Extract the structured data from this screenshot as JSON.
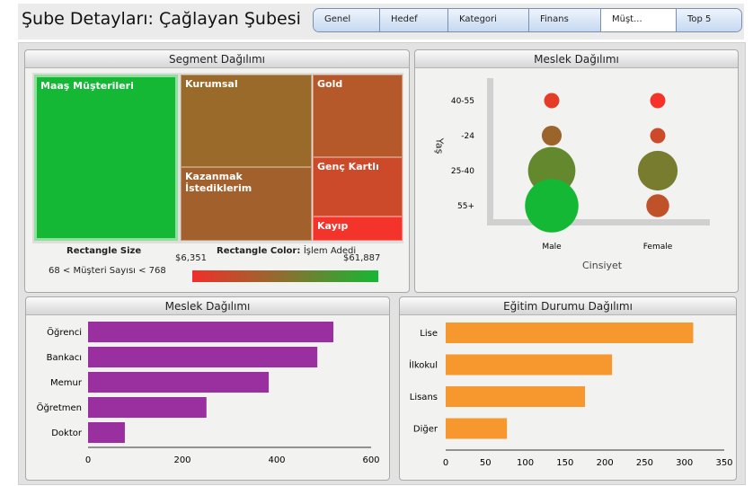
{
  "header": {
    "title": "Şube Detayları: Çağlayan Şubesi",
    "tabs": [
      {
        "label": "Genel"
      },
      {
        "label": "Hedef"
      },
      {
        "label": "Kategori"
      },
      {
        "label": "Finans"
      },
      {
        "label": "Müşt...",
        "active": true
      },
      {
        "label": "Top 5"
      }
    ]
  },
  "segment": {
    "title": "Segment Dağılımı",
    "cells": [
      {
        "label": "Maaş Müşterileri",
        "color": "#14b834"
      },
      {
        "label": "Kurumsal",
        "color": "#9a6a2a"
      },
      {
        "label": "Kazanmak İstediklerim",
        "color": "#a2602c"
      },
      {
        "label": "Gold",
        "color": "#b5592a"
      },
      {
        "label": "Genç Kartlı",
        "color": "#cc4a2a"
      },
      {
        "label": "Kayıp",
        "color": "#f4332a"
      }
    ],
    "size_heading": "Rectangle Size",
    "size_text": "68 < Müşteri Sayısı < 768",
    "color_heading": "Rectangle Color:",
    "color_metric": "İşlem Adedi",
    "color_min": "$6,351",
    "color_max": "$61,887",
    "color_low": "#f0302a",
    "color_high": "#14b834"
  },
  "bubble": {
    "title": "Meslek Dağılımı",
    "ylabel": "Yaş",
    "xlabel": "Cinsiyet",
    "y_categories": [
      "40-55",
      "-24",
      "25-40",
      "55+"
    ],
    "x_categories": [
      "Male",
      "Female"
    ],
    "points": [
      {
        "x": "Male",
        "y": "40-55",
        "size": 1,
        "color": "#e53c28"
      },
      {
        "x": "Male",
        "y": "-24",
        "size": 1.3,
        "color": "#9a642a"
      },
      {
        "x": "Male",
        "y": "25-40",
        "size": 3.1,
        "color": "#64882e"
      },
      {
        "x": "Male",
        "y": "55+",
        "size": 3.5,
        "color": "#14b834"
      },
      {
        "x": "Female",
        "y": "40-55",
        "size": 1,
        "color": "#f4332a"
      },
      {
        "x": "Female",
        "y": "-24",
        "size": 1,
        "color": "#cc4a2a"
      },
      {
        "x": "Female",
        "y": "25-40",
        "size": 2.6,
        "color": "#787c2e"
      },
      {
        "x": "Female",
        "y": "55+",
        "size": 1.5,
        "color": "#c0522a"
      }
    ]
  },
  "chart_data": [
    {
      "type": "bar",
      "title": "Meslek Dağılımı",
      "orientation": "horizontal",
      "categories": [
        "Öğrenci",
        "Bankacı",
        "Memur",
        "Öğretmen",
        "Doktor"
      ],
      "values": [
        520,
        486,
        383,
        251,
        78
      ],
      "xlim": [
        0,
        600
      ],
      "ticks": [
        "0",
        "200",
        "400",
        "600"
      ],
      "color": "#9a2fa0"
    },
    {
      "type": "bar",
      "title": "Eğitim Durumu Dağılımı",
      "orientation": "horizontal",
      "categories": [
        "Lise",
        "İlkokul",
        "Lisans",
        "Diğer"
      ],
      "values": [
        311,
        209,
        175,
        77
      ],
      "xlim": [
        0,
        350
      ],
      "ticks": [
        "0",
        "50",
        "100",
        "150",
        "200",
        "250",
        "300",
        "350"
      ],
      "color": "#f7982f"
    }
  ]
}
